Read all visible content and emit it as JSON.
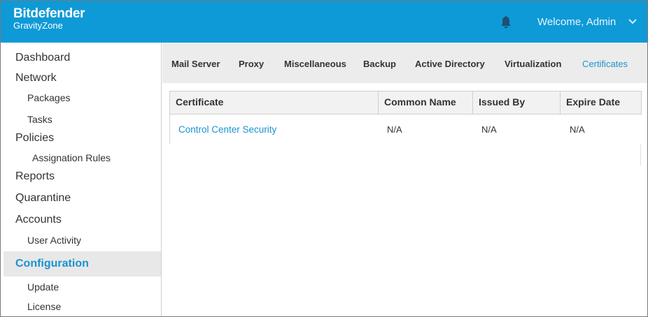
{
  "header": {
    "brand": "Bitdefender",
    "product": "GravityZone",
    "welcome": "Welcome, Admin",
    "bg_color": "#0e9ad7",
    "icons": {
      "notifications": "bell-icon",
      "user_menu": "chevron-down-icon"
    }
  },
  "sidebar": {
    "items": [
      {
        "label": "Dashboard",
        "level": 0
      },
      {
        "label": "Network",
        "level": 0
      },
      {
        "label": "Packages",
        "level": 1
      },
      {
        "label": "Tasks",
        "level": 1
      },
      {
        "label": "Policies",
        "level": 0
      },
      {
        "label": "Assignation Rules",
        "level": 2
      },
      {
        "label": "Reports",
        "level": 0
      },
      {
        "label": "Quarantine",
        "level": 0
      },
      {
        "label": "Accounts",
        "level": 0
      },
      {
        "label": "User Activity",
        "level": 1
      },
      {
        "label": "Configuration",
        "level": 0,
        "active": true
      },
      {
        "label": "Update",
        "level": 1
      },
      {
        "label": "License",
        "level": 1
      }
    ]
  },
  "tabs": [
    {
      "label": "Mail Server"
    },
    {
      "label": "Proxy"
    },
    {
      "label": "Miscellaneous"
    },
    {
      "label": "Backup"
    },
    {
      "label": "Active Directory"
    },
    {
      "label": "Virtualization"
    },
    {
      "label": "Certificates",
      "active": true
    }
  ],
  "table": {
    "columns": [
      "Certificate",
      "Common Name",
      "Issued By",
      "Expire Date"
    ],
    "rows": [
      [
        "Control Center Security",
        "N/A",
        "N/A",
        "N/A"
      ]
    ]
  },
  "accent_color": "#1a93cf"
}
